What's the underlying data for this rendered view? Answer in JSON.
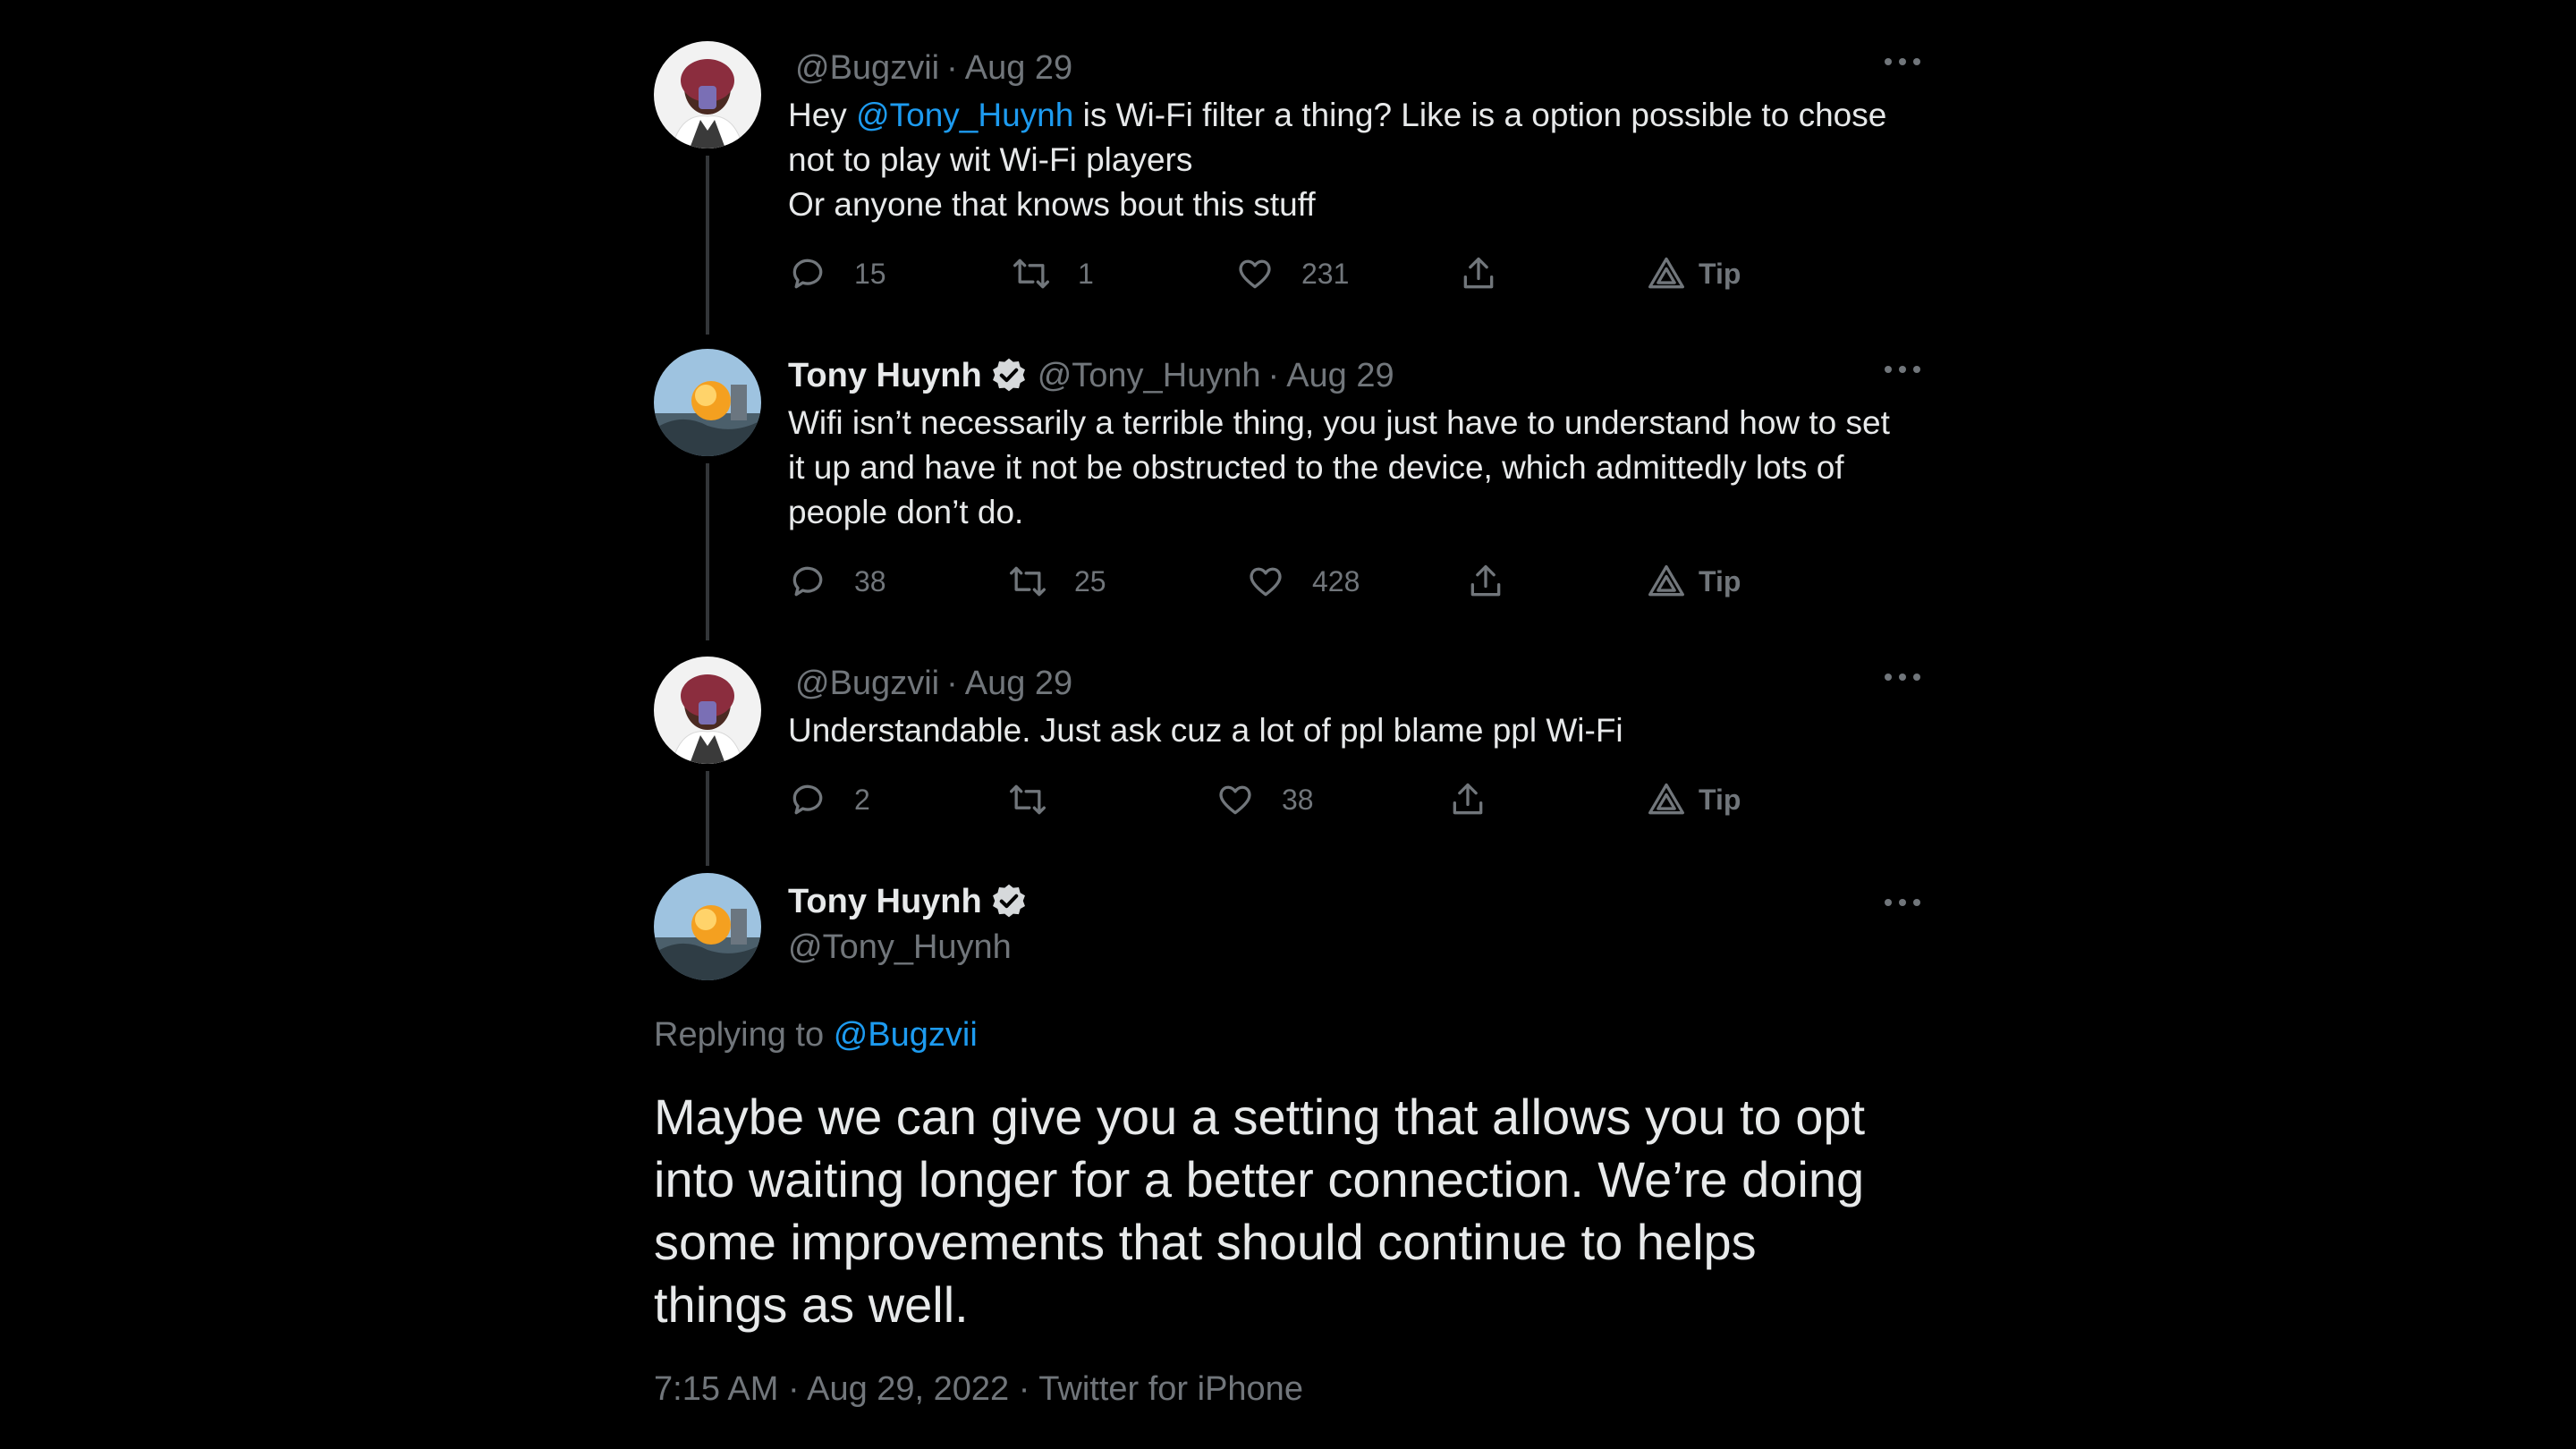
{
  "tweets": [
    {
      "name": "",
      "handle": "@Bugzvii",
      "date": "Aug 29",
      "text_prefix": "Hey ",
      "mention": "@Tony_Huynh",
      "text_line1_rest": " is Wi-Fi filter a thing? Like is a option possible to chose",
      "text_line2": "not to play wit Wi-Fi players",
      "text_line3": "Or anyone that knows bout this stuff",
      "replies": "15",
      "retweets": "1",
      "likes": "231",
      "tip": "Tip"
    },
    {
      "name": "Tony Huynh",
      "handle": "@Tony_Huynh",
      "date": "Aug 29",
      "text_line1": "Wifi isn’t necessarily a terrible thing, you just have to understand how to set",
      "text_line2": "it up and have it not be obstructed to the device, which admittedly lots of",
      "text_line3": "people don’t do.",
      "replies": "38",
      "retweets": "25",
      "likes": "428",
      "tip": "Tip"
    },
    {
      "name": "",
      "handle": "@Bugzvii",
      "date": "Aug 29",
      "text_line1": "Understandable. Just ask cuz a lot of ppl blame ppl Wi-Fi",
      "replies": "2",
      "retweets": "",
      "likes": "38",
      "tip": "Tip"
    }
  ],
  "main_tweet": {
    "name": "Tony Huynh",
    "handle": "@Tony_Huynh",
    "replying_label": "Replying to",
    "replying_to": "@Bugzvii",
    "text_line1": "Maybe we can give you a setting that allows you to opt",
    "text_line2": "into waiting longer for a better connection. We’re doing",
    "text_line3": "some improvements that should continue to helps",
    "text_line4": "things as well.",
    "meta": "7:15 AM · Aug 29, 2022 · Twitter for iPhone"
  },
  "icons": {
    "reply": "reply-icon",
    "retweet": "retweet-icon",
    "like": "heart-icon",
    "share": "share-icon",
    "tip": "tip-icon",
    "more": "more-icon",
    "verified": "verified-badge-icon"
  },
  "colors": {
    "background": "#000000",
    "text": "#e7e9ea",
    "secondary": "#71767b",
    "accent": "#1d9bf0",
    "thread_line": "#333639"
  }
}
